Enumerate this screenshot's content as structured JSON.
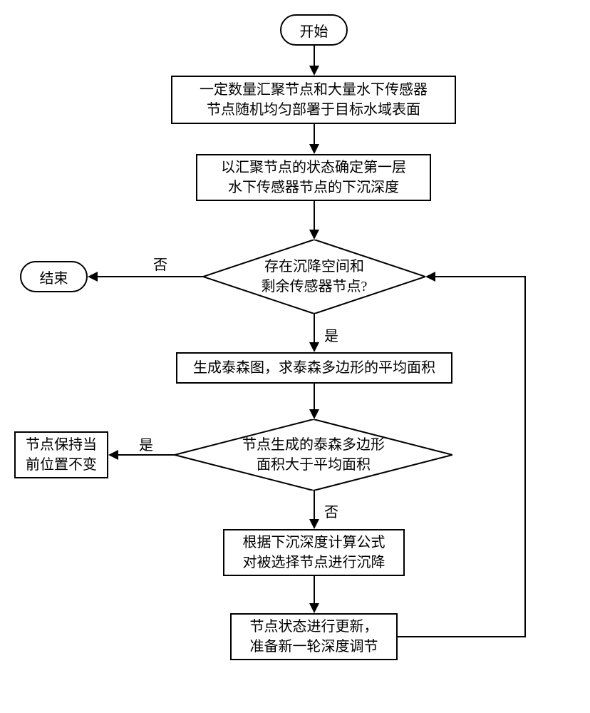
{
  "flowchart": {
    "start": "开始",
    "end": "结束",
    "step1": "一定数量汇聚节点和大量水下传感器\n节点随机均匀部署于目标水域表面",
    "step2": "以汇聚节点的状态确定第一层\n水下传感器节点的下沉深度",
    "decision1": "存在沉降空间和\n剩余传感器节点?",
    "step3": "生成泰森图，求泰森多边形的平均面积",
    "decision2": "节点生成的泰森多边形\n面积大于平均面积",
    "step4": "节点保持当\n前位置不变",
    "step5": "根据下沉深度计算公式\n对被选择节点进行沉降",
    "step6": "节点状态进行更新，\n准备新一轮深度调节",
    "yes": "是",
    "no": "否"
  }
}
